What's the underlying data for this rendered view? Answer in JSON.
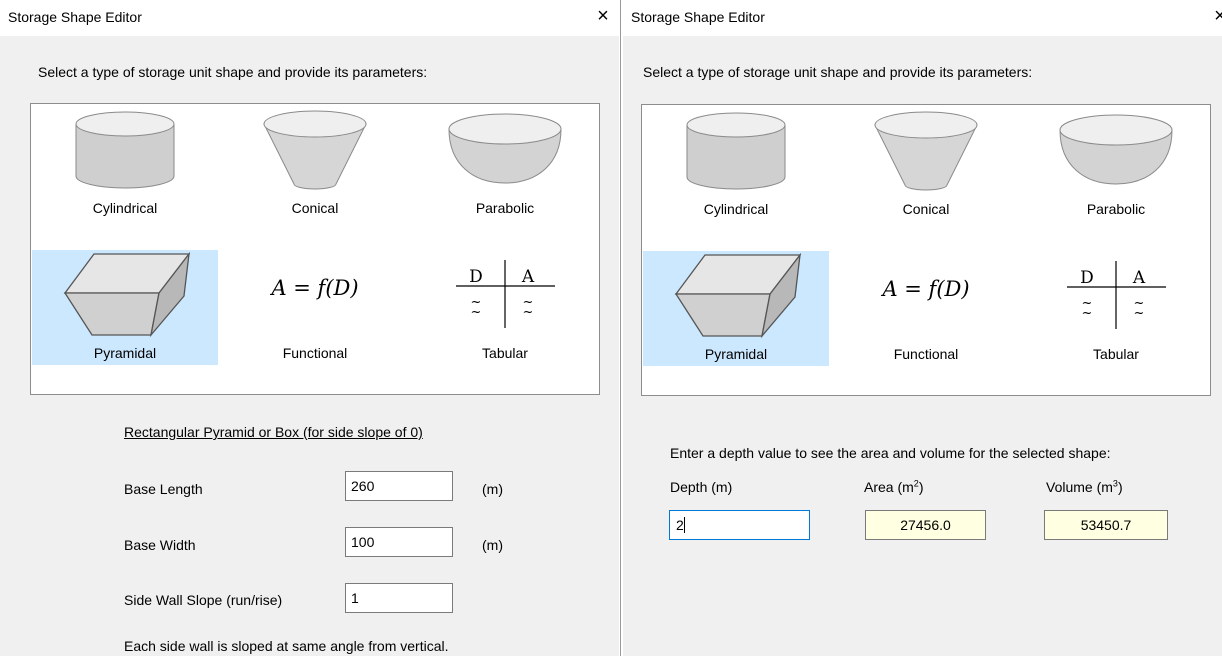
{
  "left_dialog": {
    "title": "Storage Shape Editor",
    "close_glyph": "×",
    "prompt": "Select a type of storage unit shape and provide its parameters:",
    "shapes": [
      {
        "label": "Cylindrical",
        "icon": "cylinder-icon"
      },
      {
        "label": "Conical",
        "icon": "cone-icon"
      },
      {
        "label": "Parabolic",
        "icon": "bowl-icon"
      },
      {
        "label": "Pyramidal",
        "icon": "pyramid-icon",
        "selected": true
      },
      {
        "label": "Functional",
        "formula": "A = f(D)"
      },
      {
        "label": "Tabular",
        "table_headers": [
          "D",
          "A"
        ],
        "approx": "~"
      }
    ],
    "section_title": "Rectangular Pyramid or Box (for side slope of 0)",
    "fields": [
      {
        "label": "Base Length",
        "value": "260",
        "unit": "(m)"
      },
      {
        "label": "Base Width",
        "value": "100",
        "unit": "(m)"
      },
      {
        "label": "Side Wall Slope (run/rise)",
        "value": "1",
        "unit": ""
      }
    ],
    "note": "Each side wall is sloped at same angle from vertical."
  },
  "right_dialog": {
    "title": "Storage Shape Editor",
    "close_glyph": "×",
    "prompt": "Select a type of storage unit shape and provide its parameters:",
    "shapes": [
      {
        "label": "Cylindrical"
      },
      {
        "label": "Conical"
      },
      {
        "label": "Parabolic"
      },
      {
        "label": "Pyramidal",
        "selected": true
      },
      {
        "label": "Functional",
        "formula": "A = f(D)"
      },
      {
        "label": "Tabular",
        "table_headers": [
          "D",
          "A"
        ],
        "approx": "~"
      }
    ],
    "depth_prompt": "Enter a depth value to see the area and volume for the selected shape:",
    "columns": {
      "depth_label": "Depth (m)",
      "area_label": "Area (m",
      "area_sup": "2",
      "volume_label": "Volume (m",
      "volume_sup": "3",
      "close_paren": ")"
    },
    "values": {
      "depth": "2",
      "area": "27456.0",
      "volume": "53450.7"
    }
  },
  "colors": {
    "selection": "#cce8ff",
    "output_field": "#ffffe1",
    "focus_border": "#0078d7",
    "shape_fill": "#d4d4d4"
  }
}
